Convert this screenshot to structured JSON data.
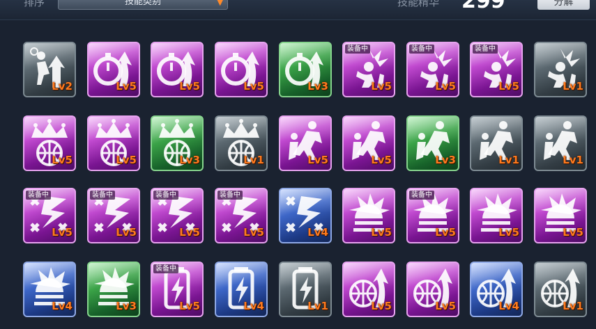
{
  "header": {
    "sort_label": "排序",
    "sort_value": "技能类别",
    "essence_label": "技能精华",
    "essence_value": "299",
    "decompose_label": "分解"
  },
  "equipped_badge": "装备中",
  "colors": {
    "purple": "#a52fbd",
    "green": "#2f8a3c",
    "blue": "#2a4fa6",
    "gray": "#4a565e",
    "level_text": "#ff7a1e"
  },
  "rows": [
    [
      {
        "icon": "dunk-icon",
        "color": "gray",
        "level": "Lv2",
        "equipped": false
      },
      {
        "icon": "stopwatch-arrow-icon",
        "color": "purple",
        "level": "Lv5",
        "equipped": false
      },
      {
        "icon": "stopwatch-arrow-icon",
        "color": "purple",
        "level": "Lv5",
        "equipped": false
      },
      {
        "icon": "stopwatch-arrow-icon",
        "color": "purple",
        "level": "Lv5",
        "equipped": false
      },
      {
        "icon": "stopwatch-arrow-icon",
        "color": "green",
        "level": "Lv3",
        "equipped": false
      },
      {
        "icon": "power-dunk-icon",
        "color": "purple",
        "level": "Lv5",
        "equipped": true
      },
      {
        "icon": "power-dunk-icon",
        "color": "purple",
        "level": "Lv5",
        "equipped": true
      },
      {
        "icon": "power-dunk-icon",
        "color": "purple",
        "level": "Lv5",
        "equipped": true
      },
      {
        "icon": "power-dunk-icon",
        "color": "gray",
        "level": "Lv1",
        "equipped": false
      }
    ],
    [
      {
        "icon": "crown-basketball-icon",
        "color": "purple",
        "level": "Lv5",
        "equipped": false
      },
      {
        "icon": "crown-basketball-icon",
        "color": "purple",
        "level": "Lv5",
        "equipped": false
      },
      {
        "icon": "crown-basketball-icon",
        "color": "green",
        "level": "Lv3",
        "equipped": false
      },
      {
        "icon": "crown-basketball-icon",
        "color": "gray",
        "level": "Lv1",
        "equipped": false
      },
      {
        "icon": "players-leap-icon",
        "color": "purple",
        "level": "Lv5",
        "equipped": false
      },
      {
        "icon": "players-leap-icon",
        "color": "purple",
        "level": "Lv5",
        "equipped": false
      },
      {
        "icon": "players-leap-icon",
        "color": "green",
        "level": "Lv3",
        "equipped": false
      },
      {
        "icon": "players-leap-icon",
        "color": "gray",
        "level": "Lv1",
        "equipped": false
      },
      {
        "icon": "players-leap-icon",
        "color": "gray",
        "level": "Lv1",
        "equipped": false
      }
    ],
    [
      {
        "icon": "tactics-bolt-icon",
        "color": "purple",
        "level": "Lv5",
        "equipped": true
      },
      {
        "icon": "tactics-bolt-icon",
        "color": "purple",
        "level": "Lv5",
        "equipped": true
      },
      {
        "icon": "tactics-bolt-icon",
        "color": "purple",
        "level": "Lv5",
        "equipped": true
      },
      {
        "icon": "tactics-bolt-icon",
        "color": "purple",
        "level": "Lv5",
        "equipped": true
      },
      {
        "icon": "tactics-bolt-icon",
        "color": "blue",
        "level": "Lv4",
        "equipped": false
      },
      {
        "icon": "basketball-burst-icon",
        "color": "purple",
        "level": "Lv5",
        "equipped": false
      },
      {
        "icon": "basketball-burst-icon",
        "color": "purple",
        "level": "Lv5",
        "equipped": true
      },
      {
        "icon": "basketball-burst-icon",
        "color": "purple",
        "level": "Lv5",
        "equipped": false
      },
      {
        "icon": "basketball-burst-icon",
        "color": "purple",
        "level": "Lv5",
        "equipped": false
      }
    ],
    [
      {
        "icon": "basketball-burst-icon",
        "color": "blue",
        "level": "Lv4",
        "equipped": false
      },
      {
        "icon": "basketball-burst-icon",
        "color": "green",
        "level": "Lv3",
        "equipped": false
      },
      {
        "icon": "energy-can-icon",
        "color": "purple",
        "level": "Lv5",
        "equipped": true
      },
      {
        "icon": "energy-can-icon",
        "color": "blue",
        "level": "Lv4",
        "equipped": false
      },
      {
        "icon": "energy-can-icon",
        "color": "gray",
        "level": "Lv1",
        "equipped": false
      },
      {
        "icon": "basketball-arrow-icon",
        "color": "purple",
        "level": "Lv5",
        "equipped": false
      },
      {
        "icon": "basketball-arrow-icon",
        "color": "purple",
        "level": "Lv5",
        "equipped": false
      },
      {
        "icon": "basketball-arrow-icon",
        "color": "blue",
        "level": "Lv4",
        "equipped": false
      },
      {
        "icon": "basketball-arrow-icon",
        "color": "gray",
        "level": "Lv1",
        "equipped": false
      }
    ]
  ]
}
